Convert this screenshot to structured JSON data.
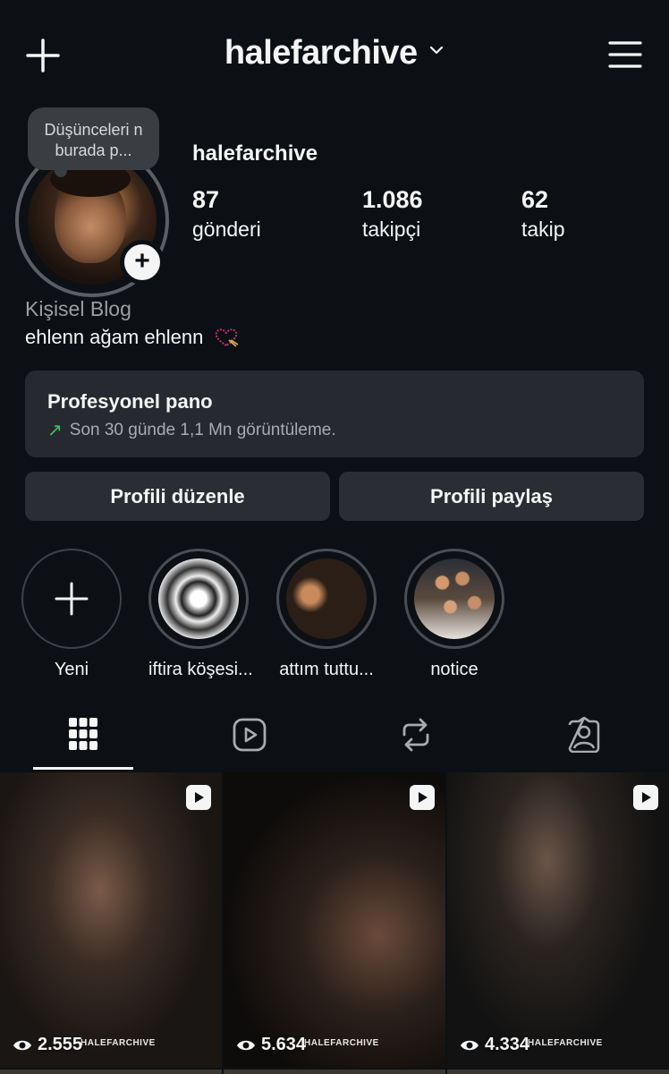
{
  "header": {
    "username": "halefarchive"
  },
  "note": {
    "text": "Düşünceleri n burada p..."
  },
  "profile": {
    "name": "halefarchive",
    "stats": [
      {
        "value": "87",
        "label": "gönderi"
      },
      {
        "value": "1.086",
        "label": "takipçi"
      },
      {
        "value": "62",
        "label": "takip"
      }
    ],
    "category": "Kişisel Blog",
    "bio": "ehlenn ağam ehlenn"
  },
  "dashboard": {
    "title": "Profesyonel pano",
    "subtitle": "Son 30 günde 1,1 Mn görüntüleme."
  },
  "buttons": {
    "edit": "Profili düzenle",
    "share": "Profili paylaş"
  },
  "highlights": [
    {
      "label": "Yeni"
    },
    {
      "label": "iftira köşesi..."
    },
    {
      "label": "attım tuttu..."
    },
    {
      "label": "notice"
    }
  ],
  "tabs": [
    "grid-icon",
    "reels-icon",
    "reposts-icon",
    "tagged-icon"
  ],
  "posts": [
    {
      "views": "2.555",
      "watermark": "HALEFARCHIVE"
    },
    {
      "views": "5.634",
      "watermark": "HALEFARCHIVE"
    },
    {
      "views": "4.334",
      "watermark": "HALEFARCHIVE"
    }
  ],
  "colors": {
    "background": "#0c1014",
    "card": "#262a30",
    "button": "#2a2e34",
    "trend_green": "#3fbf63"
  }
}
